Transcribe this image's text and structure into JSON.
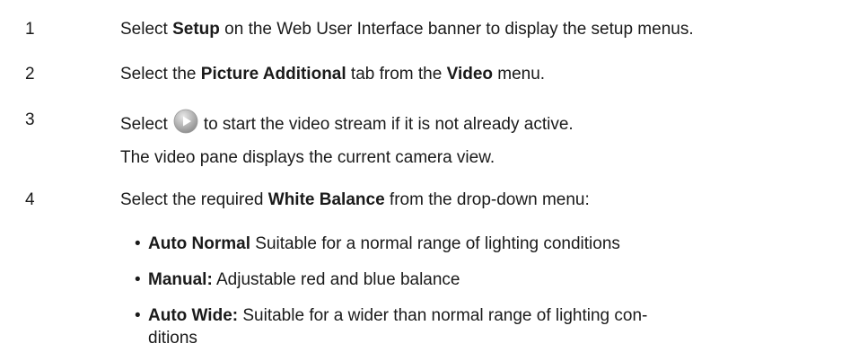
{
  "steps": [
    {
      "number": "1",
      "text_before": "Select ",
      "bold1": "Setup",
      "text_after": " on the Web User Interface banner to display the setup menus."
    },
    {
      "number": "2",
      "text_before": "Select the ",
      "bold1": "Picture Additional",
      "text_middle": " tab from the ",
      "bold2": "Video",
      "text_after": " menu."
    },
    {
      "number": "3",
      "text_before": "Select",
      "icon": "play-icon",
      "text_after": "to start the video stream if it is not already active.",
      "note": "The video pane displays the current camera view."
    },
    {
      "number": "4",
      "text_before": "Select the required ",
      "bold1": "White Balance",
      "text_after": " from the drop-down menu:"
    }
  ],
  "bullets": [
    {
      "bold": "Auto Normal",
      "text": " Suitable for a normal range of lighting conditions"
    },
    {
      "bold": "Manual:",
      "text": " Adjustable red and blue balance"
    },
    {
      "bold": "Auto Wide:",
      "text": " Suitable for a wider than normal range of lighting con-",
      "continuation": "ditions"
    }
  ],
  "colors": {
    "text": "#1a1a1a",
    "icon_fill": "#b8b8b8",
    "icon_arrow": "#ffffff"
  }
}
